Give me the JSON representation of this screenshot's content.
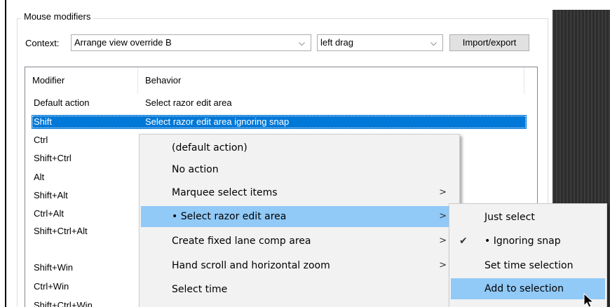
{
  "group_title": "Mouse modifiers",
  "context_label": "Context:",
  "context_value": "Arrange view override B",
  "action_value": "left drag",
  "import_export_label": "Import/export",
  "columns": {
    "modifier": "Modifier",
    "behavior": "Behavior"
  },
  "rows": [
    {
      "modifier": "Default action",
      "behavior": "Select razor edit area"
    },
    {
      "modifier": "Shift",
      "behavior": "Select razor edit area ignoring snap"
    },
    {
      "modifier": "Ctrl",
      "behavior": ""
    },
    {
      "modifier": "Shift+Ctrl",
      "behavior": ""
    },
    {
      "modifier": "Alt",
      "behavior": ""
    },
    {
      "modifier": "Shift+Alt",
      "behavior": ""
    },
    {
      "modifier": "Ctrl+Alt",
      "behavior": ""
    },
    {
      "modifier": "Shift+Ctrl+Alt",
      "behavior": ""
    },
    {
      "modifier": "Shift+Win",
      "behavior": ""
    },
    {
      "modifier": "Ctrl+Win",
      "behavior": ""
    },
    {
      "modifier": "Shift+Ctrl+Win",
      "behavior": ""
    }
  ],
  "context_menu": [
    {
      "label": "(default action)",
      "submenu": false
    },
    {
      "label": "No action",
      "submenu": false
    },
    {
      "label": "Marquee select items",
      "submenu": true
    },
    {
      "label": "• Select razor edit area",
      "submenu": true,
      "highlighted": true
    },
    {
      "label": "Create fixed lane comp area",
      "submenu": true
    },
    {
      "label": "Hand scroll and horizontal zoom",
      "submenu": true
    },
    {
      "label": "Select time",
      "submenu": false
    }
  ],
  "submenu": [
    {
      "label": "Just select"
    },
    {
      "label": "• Ignoring snap",
      "checked": true
    },
    {
      "label": "Set time selection"
    },
    {
      "label": "Add to selection",
      "highlighted": true
    }
  ],
  "glyphs": {
    "dropdown": "⌵",
    "submenu_arrow": ">",
    "check": "✔"
  },
  "colors": {
    "selection": "#0078d7",
    "menu_highlight": "#91c9f7"
  }
}
